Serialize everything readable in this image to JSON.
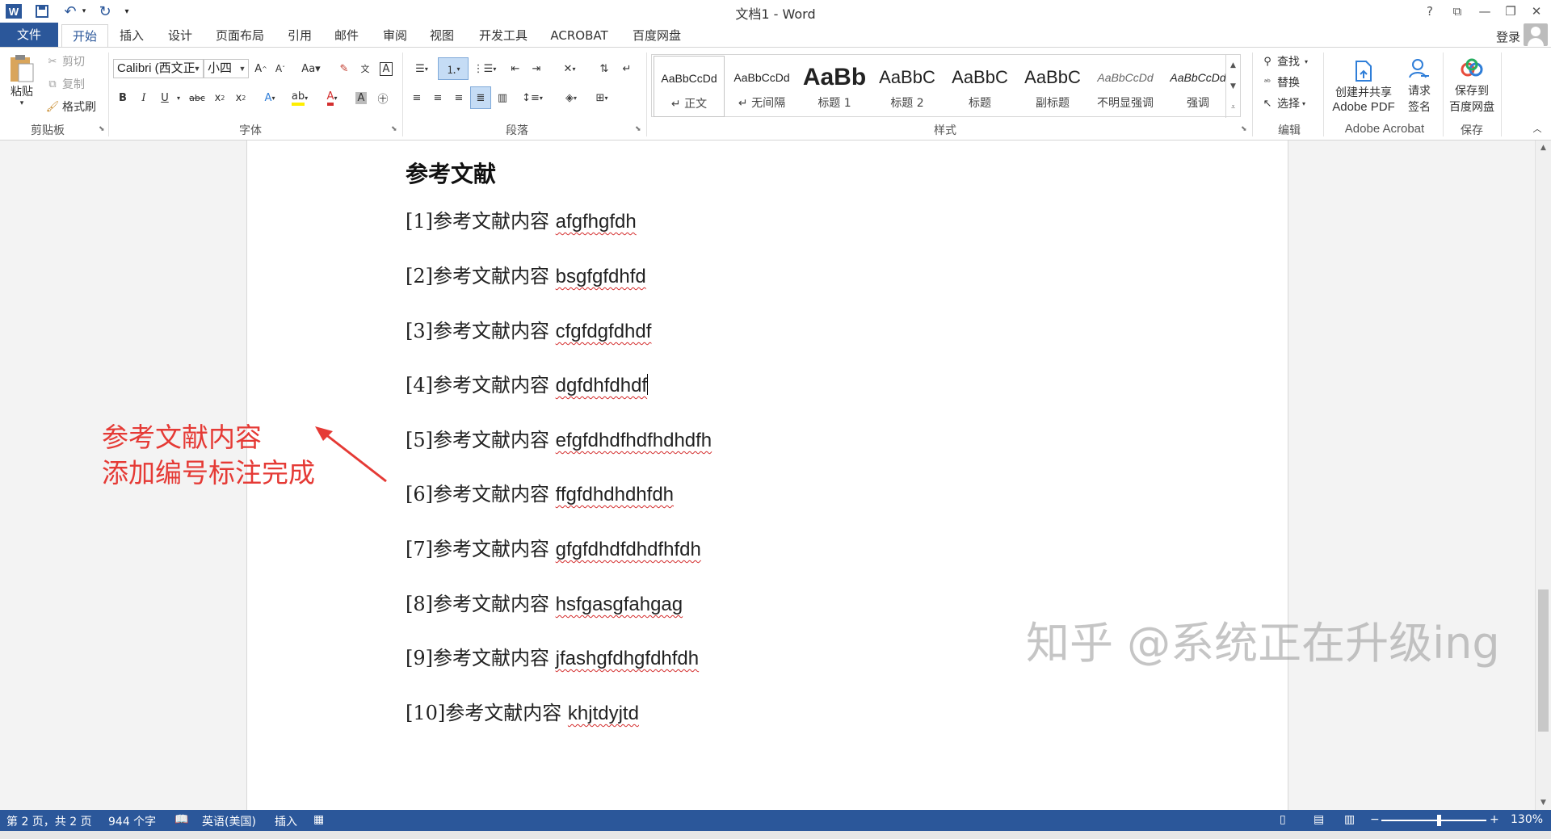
{
  "window": {
    "title": "文档1 - Word",
    "help": "?",
    "controls": [
      "⧉",
      "—",
      "❐",
      "✕"
    ]
  },
  "quick_access": {
    "customize": "▾"
  },
  "tabs": [
    "文件",
    "开始",
    "插入",
    "设计",
    "页面布局",
    "引用",
    "邮件",
    "审阅",
    "视图",
    "开发工具",
    "ACROBAT",
    "百度网盘"
  ],
  "active_tab": "开始",
  "account": {
    "login": "登录"
  },
  "ribbon": {
    "clipboard": {
      "paste": "粘贴",
      "cut": "剪切",
      "copy": "复制",
      "format_painter": "格式刷",
      "label": "剪贴板"
    },
    "font": {
      "font_name": "Calibri (西文正",
      "font_size": "小四",
      "label": "字体"
    },
    "paragraph": {
      "label": "段落"
    },
    "styles": {
      "items": [
        {
          "sample": "AaBbCcDd",
          "name": "↵ 正文"
        },
        {
          "sample": "AaBbCcDd",
          "name": "↵ 无间隔"
        },
        {
          "sample": "AaBb",
          "name": "标题 1"
        },
        {
          "sample": "AaBbC",
          "name": "标题 2"
        },
        {
          "sample": "AaBbC",
          "name": "标题"
        },
        {
          "sample": "AaBbC",
          "name": "副标题"
        },
        {
          "sample": "AaBbCcDd",
          "name": "不明显强调"
        },
        {
          "sample": "AaBbCcDd",
          "name": "强调"
        }
      ],
      "label": "样式"
    },
    "editing": {
      "find": "查找",
      "replace": "替换",
      "select": "选择",
      "label": "编辑"
    },
    "acrobat": {
      "create_share": [
        "创建并共享",
        "Adobe PDF"
      ],
      "request_sign": [
        "请求",
        "签名"
      ],
      "label": "Adobe Acrobat"
    },
    "save": {
      "save_baidu": [
        "保存到",
        "百度网盘"
      ],
      "label": "保存"
    }
  },
  "document": {
    "heading": "参考文献",
    "references": [
      {
        "num": "[1]",
        "label": "参考文献内容 ",
        "text": "afgfhgfdh"
      },
      {
        "num": "[2]",
        "label": "参考文献内容 ",
        "text": "bsgfgfdhfd"
      },
      {
        "num": "[3]",
        "label": "参考文献内容 ",
        "text": "cfgfdgfdhdf"
      },
      {
        "num": "[4]",
        "label": "参考文献内容 ",
        "text": "dgfdhfdhdf"
      },
      {
        "num": "[5]",
        "label": "参考文献内容 ",
        "text": "efgfdhdfhdfhdhdfh"
      },
      {
        "num": "[6]",
        "label": "参考文献内容 ",
        "text": "ffgfdhdhdhfdh"
      },
      {
        "num": "[7]",
        "label": "参考文献内容 ",
        "text": "gfgfdhdfdhdfhfdh"
      },
      {
        "num": "[8]",
        "label": "参考文献内容 ",
        "text": "hsfgasgfahgag"
      },
      {
        "num": "[9]",
        "label": "参考文献内容 ",
        "text": "jfashgfdhgfdhfdh"
      },
      {
        "num": "[10]",
        "label": "参考文献内容 ",
        "text": "khjtdyjtd"
      }
    ]
  },
  "annotation": {
    "line1": "参考文献内容",
    "line2": "添加编号标注完成",
    "color": "#e53a35"
  },
  "watermark": "知乎 @系统正在升级ing",
  "statusbar": {
    "page": "第 2 页，共 2 页",
    "words": "944 个字",
    "language": "英语(美国)",
    "mode": "插入",
    "zoom": "130%"
  },
  "colors": {
    "accent": "#2b579a",
    "spell_underline": "#d42d2d"
  }
}
